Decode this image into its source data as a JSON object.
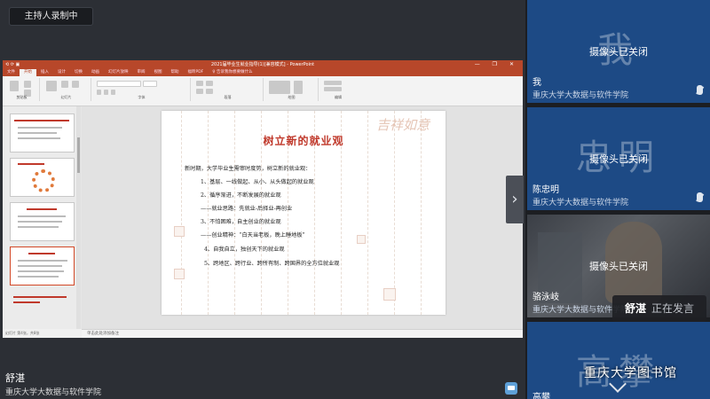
{
  "recording_badge": "主持人录制中",
  "ppt": {
    "title": "2021届毕业生就业指导(1)[兼容模式] - PowerPoint",
    "quick_access": "⟲ ⟳ ▣",
    "window_controls": "— ❐ ✕",
    "tabs": [
      "文件",
      "开始",
      "插入",
      "设计",
      "切换",
      "动画",
      "幻灯片放映",
      "审阅",
      "视图",
      "帮助",
      "福昕PDF",
      "♀ 告诉我你想要做什么"
    ],
    "ribbon_groups": [
      "剪贴板",
      "幻灯片",
      "字体",
      "段落",
      "绘图",
      "编辑"
    ],
    "slide": {
      "title": "树立新的就业观",
      "lines": [
        "新时期，大学毕业生需审时度势，树立新的就业观：",
        "1、基层、一线做起、从小、从头做起的就业观",
        "2、循序渐进，不断发展的就业观",
        "——就业思路：先就业-后择业-再创业",
        "3、不怕困难，自主创业的就业观",
        "——创业精神：“白天当老板，晚上睡地板”",
        "4、自我自立，独创天下的就业观",
        "5、跨地区、跨行业、跨所有制、跨国界的全方位就业观"
      ],
      "calligraphy": "吉祥如意"
    },
    "thumbnails": [
      {
        "num": "1",
        "title": "高校毕业生就业有关政策"
      },
      {
        "num": "2",
        "title": "就业观念的转变"
      },
      {
        "num": "3",
        "title": "择业心理调适"
      },
      {
        "num": "4",
        "title": "树立新的就业观"
      },
      {
        "num": "5",
        "title": "一、开拓视野，正确看待就业形势"
      }
    ],
    "notes_placeholder": "单击此处添加备注",
    "status": "幻灯片 第4张，共8张"
  },
  "speaker": {
    "name": "舒湛",
    "org": "重庆大学大数据与软件学院"
  },
  "participants": [
    {
      "avatar_text": "我",
      "camera_status": "摄像头已关闭",
      "name": "我",
      "org": "重庆大学大数据与软件学院",
      "has_video": false
    },
    {
      "avatar_text": "忠明",
      "camera_status": "摄像头已关闭",
      "name": "陈忠明",
      "org": "重庆大学大数据与软件学院",
      "has_video": false
    },
    {
      "avatar_text": "",
      "camera_status": "摄像头已关闭",
      "name": "骆泳岐",
      "org": "重庆大学大数据与软件学院",
      "has_video": true
    },
    {
      "avatar_text": "高攀",
      "camera_status": "",
      "name": "高攀",
      "org": "",
      "has_video": false
    }
  ],
  "speaking_indicator": {
    "name": "舒湛",
    "status": "正在发言"
  },
  "watermark": "重庆大学图书馆",
  "icons": {
    "next": "chevron-right-icon",
    "mic": "mic-muted-icon",
    "chat": "chat-icon",
    "expand": "chevron-down-icon"
  },
  "colors": {
    "tile_blue": "#1d4a85",
    "ppt_red": "#b7472a",
    "slide_title": "#c0392b"
  }
}
